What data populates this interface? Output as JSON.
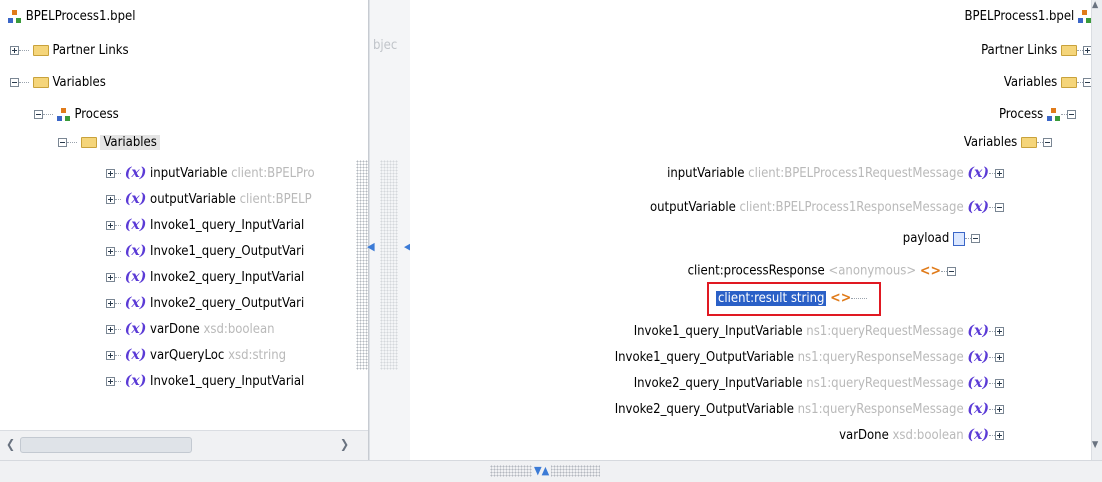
{
  "left_tree": {
    "root": "BPELProcess1.bpel",
    "partner_links": "Partner Links",
    "variables": "Variables",
    "process": "Process",
    "process_variables": "Variables",
    "items": [
      {
        "name": "inputVariable",
        "type": "client:BPELPro"
      },
      {
        "name": "outputVariable",
        "type": "client:BPELP"
      },
      {
        "name": "Invoke1_query_InputVarial",
        "type": ""
      },
      {
        "name": "Invoke1_query_OutputVari",
        "type": ""
      },
      {
        "name": "Invoke2_query_InputVarial",
        "type": ""
      },
      {
        "name": "Invoke2_query_OutputVari",
        "type": ""
      },
      {
        "name": "varDone",
        "type": "xsd:boolean"
      },
      {
        "name": "varQueryLoc",
        "type": "xsd:string"
      },
      {
        "name": "Invoke1_query_InputVarial",
        "type": ""
      }
    ]
  },
  "middle": {
    "label": "bjec"
  },
  "right_tree": {
    "root": "BPELProcess1.bpel",
    "partner_links": "Partner Links",
    "variables": "Variables",
    "process": "Process",
    "process_variables": "Variables",
    "input_variable": {
      "name": "inputVariable",
      "type": "client:BPELProcess1RequestMessage"
    },
    "output_variable": {
      "name": "outputVariable",
      "type": "client:BPELProcess1ResponseMessage"
    },
    "payload": "payload",
    "process_response": {
      "name": "client:processResponse",
      "type": "<anonymous>"
    },
    "client_result": "client:result string",
    "items": [
      {
        "name": "Invoke1_query_InputVariable",
        "type": "ns1:queryRequestMessage"
      },
      {
        "name": "Invoke1_query_OutputVariable",
        "type": "ns1:queryResponseMessage"
      },
      {
        "name": "Invoke2_query_InputVariable",
        "type": "ns1:queryRequestMessage"
      },
      {
        "name": "Invoke2_query_OutputVariable",
        "type": "ns1:queryResponseMessage"
      },
      {
        "name": "varDone",
        "type": "xsd:boolean"
      }
    ]
  },
  "icons": {
    "variable": "(x)",
    "element": "<>",
    "folder": "folder-icon",
    "process": "process-icon",
    "payload": "payload-icon"
  },
  "colors": {
    "highlight_border": "#e01922",
    "selection": "#2a60c7",
    "variable_icon": "#5b3bd6"
  }
}
